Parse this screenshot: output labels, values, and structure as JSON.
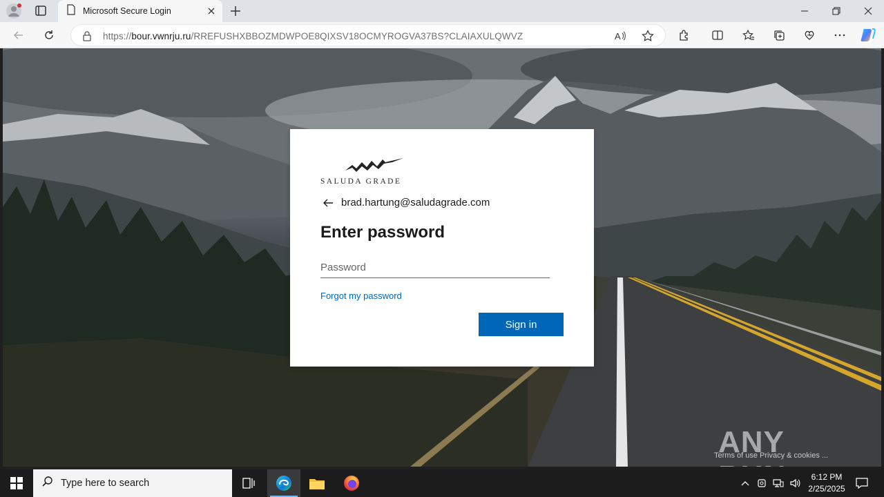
{
  "browser": {
    "tab_title": "Microsoft Secure Login",
    "url_prefix": "https://",
    "url_host": "bour.vwnrju.ru",
    "url_path": "/RREFUSHXBBOZMDWPOE8QIXSV18OCMYROGVA37BS?CLAIAXULQWVZ",
    "icons": [
      "profile-icon",
      "tab-actions-icon",
      "page-icon",
      "close-icon",
      "new-tab-icon",
      "minimize-icon",
      "restore-icon",
      "window-close-icon",
      "back-icon",
      "refresh-icon",
      "lock-icon",
      "read-aloud-icon",
      "favorite-icon",
      "extensions-icon",
      "split-screen-icon",
      "favorites-icon",
      "collections-icon",
      "browser-essentials-icon",
      "more-icon",
      "copilot-icon"
    ]
  },
  "login": {
    "brand": "SALUDA GRADE",
    "email": "brad.hartung@saludagrade.com",
    "heading": "Enter password",
    "password_placeholder": "Password",
    "forgot_link": "Forgot my password",
    "signin_label": "Sign in",
    "accent_color": "#0067b8"
  },
  "page_footer": {
    "links": "Terms of use   Privacy & cookies   ..."
  },
  "watermark": {
    "text": "ANY RUN"
  },
  "taskbar": {
    "search_placeholder": "Type here to search",
    "apps": [
      "task-view-icon",
      "edge-icon",
      "file-explorer-icon",
      "firefox-icon"
    ],
    "time": "6:12 PM",
    "date": "2/25/2025"
  }
}
